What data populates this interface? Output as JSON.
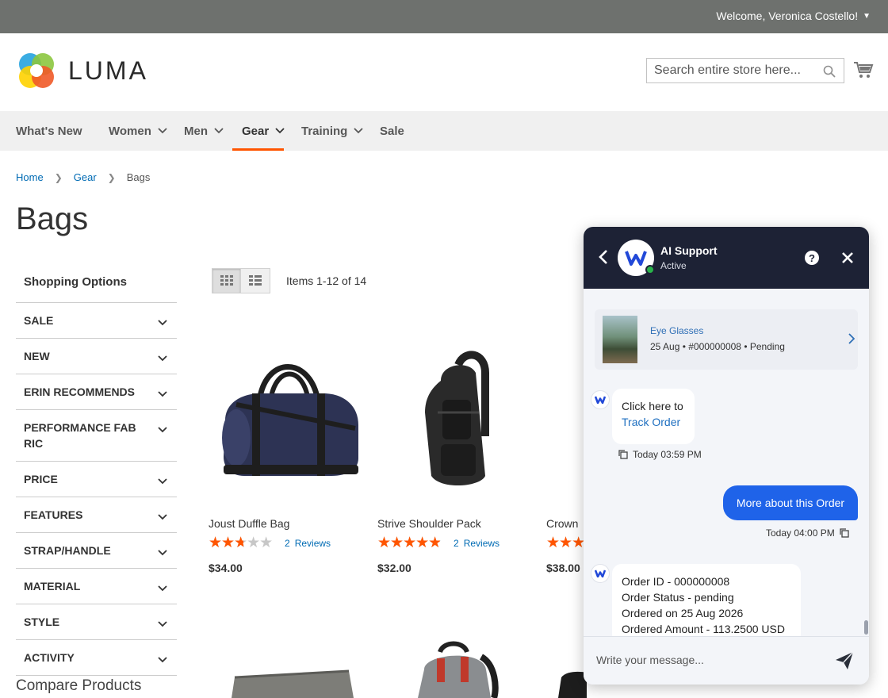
{
  "topbar": {
    "welcome": "Welcome, Veronica Costello!"
  },
  "header": {
    "logo_text": "LUMA",
    "search_placeholder": "Search entire store here...",
    "accent": "#ff5501"
  },
  "nav": {
    "items": [
      {
        "label": "What's New"
      },
      {
        "label": "Women"
      },
      {
        "label": "Men"
      },
      {
        "label": "Gear",
        "active": true
      },
      {
        "label": "Training"
      },
      {
        "label": "Sale"
      }
    ]
  },
  "breadcrumb": {
    "home": "Home",
    "gear": "Gear",
    "current": "Bags"
  },
  "page": {
    "title": "Bags"
  },
  "sidebar": {
    "title": "Shopping Options",
    "filters": [
      "SALE",
      "NEW",
      "ERIN RECOMMENDS",
      "PERFORMANCE FABRIC",
      "PRICE",
      "FEATURES",
      "STRAP/HANDLE",
      "MATERIAL",
      "STYLE",
      "ACTIVITY"
    ],
    "compare_title": "Compare Products"
  },
  "toolbar": {
    "items_count": "Items 1-12 of 14"
  },
  "products": [
    {
      "name": "Joust Duffle Bag",
      "rating_fraction": 0.5,
      "reviews_count": "2",
      "reviews_label": "Reviews",
      "price": "$34.00"
    },
    {
      "name": "Strive Shoulder Pack",
      "rating_fraction": 0.9,
      "reviews_count": "2",
      "reviews_label": "Reviews",
      "price": "$32.00"
    },
    {
      "name": "Crown",
      "rating_fraction": 0.6,
      "reviews_count": "",
      "reviews_label": "",
      "price": "$38.00"
    }
  ],
  "chat": {
    "title": "AI Support",
    "status": "Active",
    "header_color": "#1d2235",
    "order_card": {
      "name": "Eye Glasses",
      "meta": "25 Aug • #000000008 • Pending"
    },
    "messages": {
      "bot1_line1": "Click here to",
      "bot1_link": "Track Order",
      "bot1_time": "Today 03:59 PM",
      "user1": "More about this Order",
      "user1_time": "Today 04:00 PM",
      "bot2_line1": "Order ID - 000000008",
      "bot2_line2": "Order Status - pending",
      "bot2_line3": "Ordered on 25 Aug 2026",
      "bot2_line4": "Ordered Amount - 113.2500 USD"
    },
    "input_placeholder": "Write your message...",
    "user_bubble_color": "#1f63e9"
  }
}
